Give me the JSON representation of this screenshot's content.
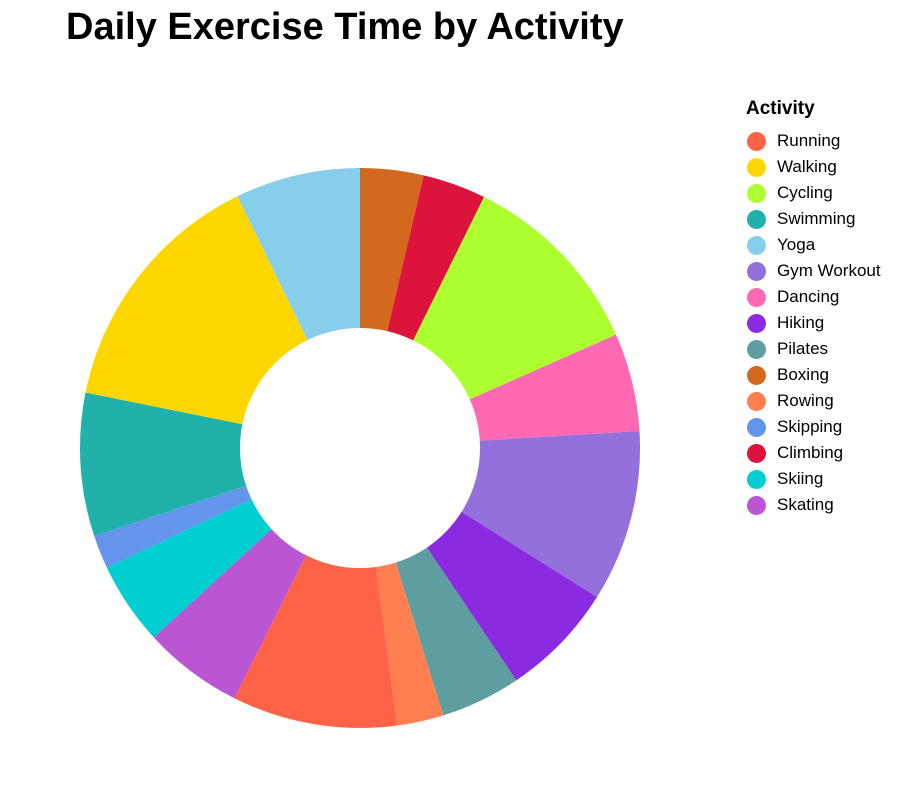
{
  "chart_data": {
    "type": "pie",
    "variant": "donut",
    "title": "Daily Exercise Time by Activity",
    "legend": {
      "title": "Activity",
      "placement": "right"
    },
    "slices": [
      {
        "label": "Boxing",
        "value": 3.8,
        "color": "#D2691E"
      },
      {
        "label": "Climbing",
        "value": 3.8,
        "color": "#DC143C"
      },
      {
        "label": "Cycling",
        "value": 11.5,
        "color": "#ADFF2F"
      },
      {
        "label": "Dancing",
        "value": 5.9,
        "color": "#FF69B4"
      },
      {
        "label": "Gym Workout",
        "value": 10.3,
        "color": "#9370DB"
      },
      {
        "label": "Hiking",
        "value": 6.9,
        "color": "#8A2BE2"
      },
      {
        "label": "Pilates",
        "value": 4.8,
        "color": "#5F9EA0"
      },
      {
        "label": "Rowing",
        "value": 2.8,
        "color": "#FF7F50"
      },
      {
        "label": "Running",
        "value": 9.9,
        "color": "#FF6347"
      },
      {
        "label": "Skating",
        "value": 6.0,
        "color": "#BA55D3"
      },
      {
        "label": "Skiing",
        "value": 5.0,
        "color": "#00CED1"
      },
      {
        "label": "Skipping",
        "value": 2.0,
        "color": "#6495ED"
      },
      {
        "label": "Swimming",
        "value": 8.6,
        "color": "#20B2AA"
      },
      {
        "label": "Walking",
        "value": 15.2,
        "color": "#FFD700"
      },
      {
        "label": "Yoga",
        "value": 7.5,
        "color": "#87CEEB"
      }
    ],
    "legend_order": [
      "Running",
      "Walking",
      "Cycling",
      "Swimming",
      "Yoga",
      "Gym Workout",
      "Dancing",
      "Hiking",
      "Pilates",
      "Boxing",
      "Rowing",
      "Skipping",
      "Climbing",
      "Skiing",
      "Skating"
    ]
  }
}
